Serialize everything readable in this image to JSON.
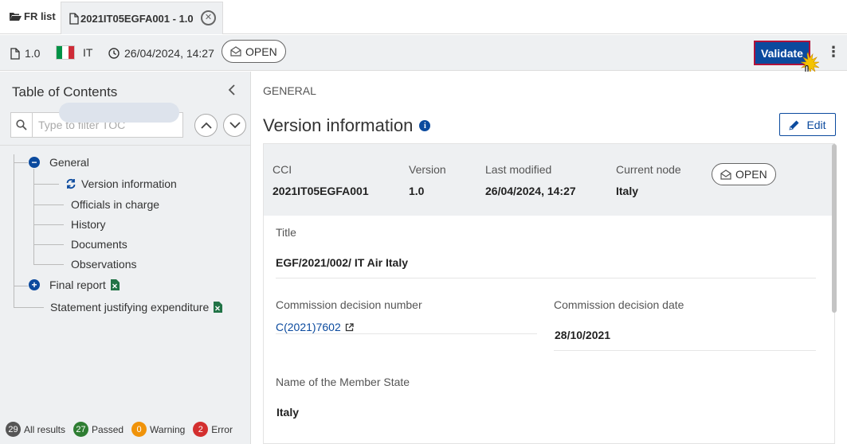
{
  "tabs": {
    "fr_list": "FR list",
    "active": "2021IT05EGFA001 - 1.0"
  },
  "toolbar": {
    "version": "1.0",
    "country": "IT",
    "datetime": "26/04/2024, 14:27",
    "status": "OPEN",
    "validate": "Validate",
    "more": "⋮"
  },
  "toc": {
    "title": "Table of Contents",
    "filter_placeholder": "Type to filter TOC",
    "nodes": {
      "general": "General",
      "version_information": "Version information",
      "officials_in_charge": "Officials in charge",
      "history": "History",
      "documents": "Documents",
      "observations": "Observations",
      "final_report": "Final report",
      "statement": "Statement justifying expenditure"
    },
    "summary": {
      "all_count": "29",
      "all_label": "All results",
      "passed_count": "27",
      "passed_label": "Passed",
      "warning_count": "0",
      "warning_label": "Warning",
      "error_count": "2",
      "error_label": "Error"
    }
  },
  "main": {
    "breadcrumb": "GENERAL",
    "title": "Version information",
    "edit": "Edit",
    "header": {
      "cci_label": "CCI",
      "cci_value": "2021IT05EGFA001",
      "version_label": "Version",
      "version_value": "1.0",
      "modified_label": "Last modified",
      "modified_value": "26/04/2024, 14:27",
      "node_label": "Current node",
      "node_value": "Italy",
      "status": "OPEN"
    },
    "fields": {
      "title_label": "Title",
      "title_value": "EGF/2021/002/ IT Air Italy",
      "decision_number_label": "Commission decision number",
      "decision_number_value": "C(2021)7602",
      "decision_date_label": "Commission decision date",
      "decision_date_value": "28/10/2021",
      "member_state_label": "Name of the Member State",
      "member_state_value": "Italy"
    }
  },
  "colors": {
    "primary": "#0b4a9e",
    "passed": "#2e7d32",
    "warning": "#f0930a",
    "error": "#d32f2f",
    "neutral": "#555555",
    "excel": "#217346"
  }
}
